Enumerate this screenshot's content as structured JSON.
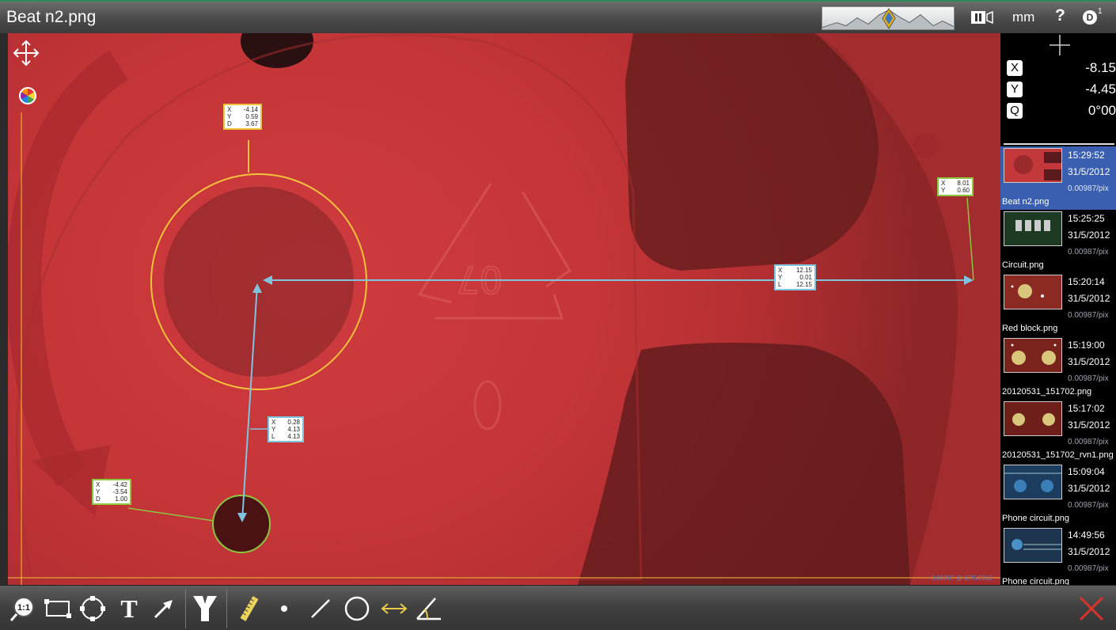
{
  "window": {
    "title": "Beat n2.png"
  },
  "header": {
    "units": "mm",
    "help": "?",
    "camera_label": "D",
    "camera_index": "1",
    "icons": [
      "logo-mountain-icon",
      "freeze-frame-icon",
      "help-icon",
      "camera-icon"
    ]
  },
  "measurements": {
    "circle_large": {
      "x_label": "X",
      "x": "-4.14",
      "y_label": "Y",
      "y": "0.59",
      "d_label": "D",
      "d": "3.67"
    },
    "point_right": {
      "x_label": "X",
      "x": "8.01",
      "y_label": "Y",
      "y": "0.60"
    },
    "distance_horizontal": {
      "x_label": "X",
      "x": "12.15",
      "y_label": "Y",
      "y": "0.01",
      "l_label": "L",
      "l": "12.15"
    },
    "distance_vertical": {
      "x_label": "X",
      "x": "0.28",
      "y_label": "Y",
      "y": "4.13",
      "l_label": "L",
      "l": "4.13"
    },
    "circle_small": {
      "x_label": "X",
      "x": "-4.42",
      "y_label": "Y",
      "y": "-3.54",
      "d_label": "D",
      "d": "1.00"
    }
  },
  "viewport": {
    "scale_stamp": "0.00987 @ 17/5/2012"
  },
  "readout": {
    "x_key": "X",
    "x": "-8.15",
    "y_key": "Y",
    "y": "-4.45",
    "q_key": "Q",
    "q": "0°00"
  },
  "gallery": [
    {
      "time": "15:29:52",
      "date": "31/5/2012",
      "scale": "0.00987/pix",
      "name": "Beat n2.png",
      "active": true
    },
    {
      "time": "15:25:25",
      "date": "31/5/2012",
      "scale": "0.00987/pix",
      "name": "Circuit.png"
    },
    {
      "time": "15:20:14",
      "date": "31/5/2012",
      "scale": "0.00987/pix",
      "name": "Red block.png"
    },
    {
      "time": "15:19:00",
      "date": "31/5/2012",
      "scale": "0.00987/pix",
      "name": "20120531_151702.png"
    },
    {
      "time": "15:17:02",
      "date": "31/5/2012",
      "scale": "0.00987/pix",
      "name": "20120531_151702_rvn1.png"
    },
    {
      "time": "15:09:04",
      "date": "31/5/2012",
      "scale": "0.00987/pix",
      "name": "Phone circuit.png"
    },
    {
      "time": "14:49:56",
      "date": "31/5/2012",
      "scale": "0.00987/pix",
      "name": "Phone circuit.png"
    }
  ],
  "toolbar": {
    "zoom_label": "1:1",
    "text_tool": "T",
    "tools": [
      "zoom-icon",
      "select-rect-icon",
      "select-circle-icon",
      "text-icon",
      "arrow-icon",
      "y-filter-icon",
      "ruler-icon",
      "point-icon",
      "line-icon",
      "circle-icon",
      "distance-icon",
      "angle-icon",
      "close-icon"
    ]
  },
  "colors": {
    "accent": "#3b5fb0",
    "measure_yellow": "#f2c23a",
    "measure_green": "#8dc63f",
    "measure_blue": "#7fc3de",
    "close_red": "#d9342b"
  }
}
